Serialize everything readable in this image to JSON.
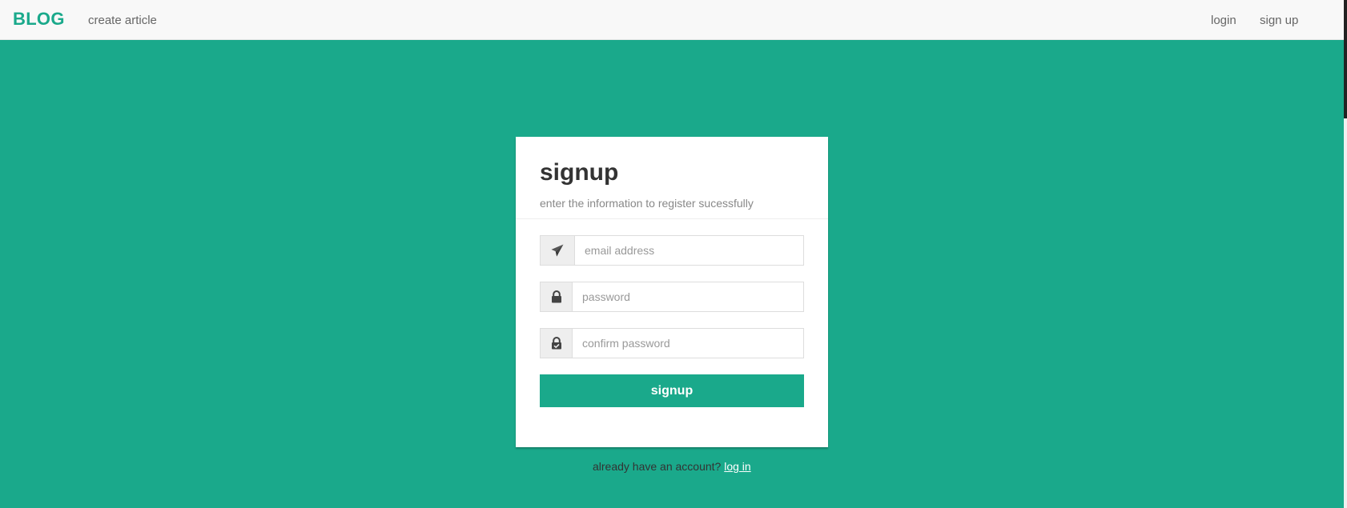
{
  "navbar": {
    "brand": "BLOG",
    "create_link": "create article",
    "login_link": "login",
    "signup_link": "sign up"
  },
  "card": {
    "title": "signup",
    "subtitle": "enter the information to register sucessfully",
    "email_placeholder": "email address",
    "password_placeholder": "password",
    "confirm_placeholder": "confirm password",
    "submit_label": "signup"
  },
  "footer": {
    "prompt": "already have an account?",
    "login_link": "log in"
  },
  "icons": {
    "email": "paper-plane-icon",
    "password": "lock-icon",
    "confirm": "lock-check-icon"
  },
  "colors": {
    "accent": "#1aa98b",
    "navbar_bg": "#f8f8f8",
    "card_bg": "#ffffff",
    "addon_bg": "#eeeeee"
  }
}
